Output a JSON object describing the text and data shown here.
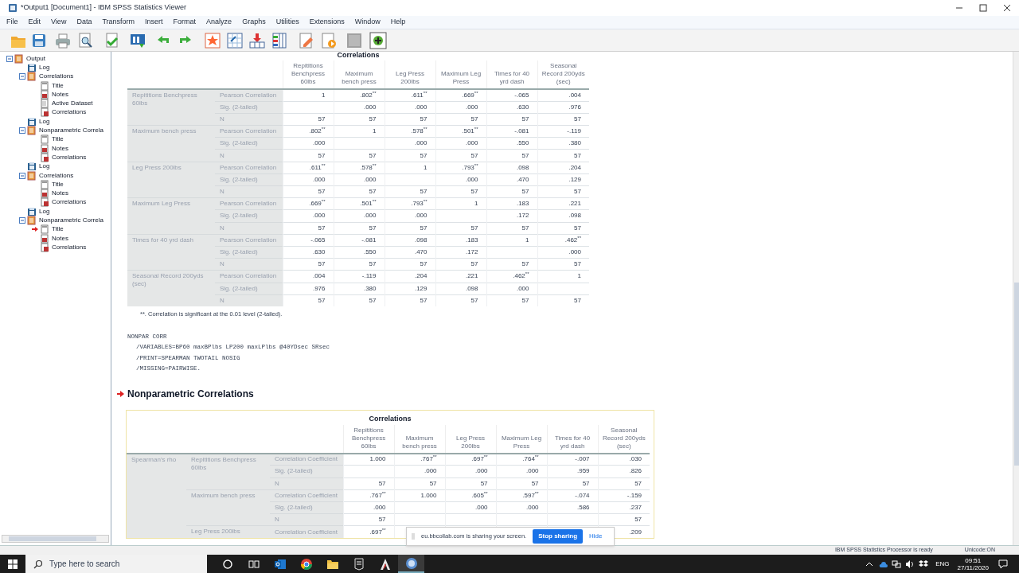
{
  "window": {
    "title": "*Output1 [Document1] - IBM SPSS Statistics Viewer"
  },
  "menu": [
    "File",
    "Edit",
    "View",
    "Data",
    "Transform",
    "Insert",
    "Format",
    "Analyze",
    "Graphs",
    "Utilities",
    "Extensions",
    "Window",
    "Help"
  ],
  "outline": [
    {
      "label": "Output",
      "kind": "folder",
      "expanded": true,
      "current": false,
      "children": [
        {
          "label": "Log",
          "kind": "log",
          "current": false
        },
        {
          "label": "Correlations",
          "kind": "folder",
          "expanded": true,
          "current": false,
          "children": [
            {
              "label": "Title",
              "kind": "title",
              "current": false
            },
            {
              "label": "Notes",
              "kind": "notes",
              "current": false
            },
            {
              "label": "Active Dataset",
              "kind": "dataset",
              "current": false
            },
            {
              "label": "Correlations",
              "kind": "table",
              "current": false
            }
          ]
        },
        {
          "label": "Log",
          "kind": "log",
          "current": false
        },
        {
          "label": "Nonparametric Correla",
          "kind": "folder",
          "expanded": true,
          "current": false,
          "children": [
            {
              "label": "Title",
              "kind": "title",
              "current": false
            },
            {
              "label": "Notes",
              "kind": "notes",
              "current": false
            },
            {
              "label": "Correlations",
              "kind": "table",
              "current": false
            }
          ]
        },
        {
          "label": "Log",
          "kind": "log",
          "current": false
        },
        {
          "label": "Correlations",
          "kind": "folder",
          "expanded": true,
          "current": false,
          "children": [
            {
              "label": "Title",
              "kind": "title",
              "current": false
            },
            {
              "label": "Notes",
              "kind": "notes",
              "current": false
            },
            {
              "label": "Correlations",
              "kind": "table",
              "current": false
            }
          ]
        },
        {
          "label": "Log",
          "kind": "log",
          "current": false
        },
        {
          "label": "Nonparametric Correla",
          "kind": "folder",
          "expanded": true,
          "current": false,
          "children": [
            {
              "label": "Title",
              "kind": "title",
              "current": true
            },
            {
              "label": "Notes",
              "kind": "notes",
              "current": false
            },
            {
              "label": "Correlations",
              "kind": "table",
              "current": false
            }
          ]
        }
      ]
    }
  ],
  "table_1": {
    "title": "Correlations",
    "columns": [
      "Repititions Benchpress 60lbs",
      "Maximum bench press",
      "Leg Press 200lbs",
      "Maximum Leg Press",
      "Times for 40 yrd dash",
      "Seasonal Record 200yds (sec)"
    ],
    "groups": [
      {
        "variable": "Repititions Benchpress 60lbs",
        "rows": [
          {
            "statistic": "Pearson Correlation",
            "cells": [
              "1",
              ".802$^{**}$",
              ".611$^{**}$",
              ".669$^{**}$",
              "-.065",
              ".004"
            ]
          },
          {
            "statistic": "Sig. (2-tailed)",
            "cells": [
              null,
              ".000",
              ".000",
              ".000",
              ".630",
              ".976"
            ]
          },
          {
            "statistic": "N",
            "cells": [
              "57",
              "57",
              "57",
              "57",
              "57",
              "57"
            ]
          }
        ]
      },
      {
        "variable": "Maximum bench press",
        "rows": [
          {
            "statistic": "Pearson Correlation",
            "cells": [
              ".802$^{**}$",
              "1",
              ".578$^{**}$",
              ".501$^{**}$",
              "-.081",
              "-.119"
            ]
          },
          {
            "statistic": "Sig. (2-tailed)",
            "cells": [
              ".000",
              null,
              ".000",
              ".000",
              ".550",
              ".380"
            ]
          },
          {
            "statistic": "N",
            "cells": [
              "57",
              "57",
              "57",
              "57",
              "57",
              "57"
            ]
          }
        ]
      },
      {
        "variable": "Leg Press 200lbs",
        "rows": [
          {
            "statistic": "Pearson Correlation",
            "cells": [
              ".611$^{**}$",
              ".578$^{**}$",
              "1",
              ".793$^{**}$",
              ".098",
              ".204"
            ]
          },
          {
            "statistic": "Sig. (2-tailed)",
            "cells": [
              ".000",
              ".000",
              null,
              ".000",
              ".470",
              ".129"
            ]
          },
          {
            "statistic": "N",
            "cells": [
              "57",
              "57",
              "57",
              "57",
              "57",
              "57"
            ]
          }
        ]
      },
      {
        "variable": "Maximum Leg Press",
        "rows": [
          {
            "statistic": "Pearson Correlation",
            "cells": [
              ".669$^{**}$",
              ".501$^{**}$",
              ".793$^{**}$",
              "1",
              ".183",
              ".221"
            ]
          },
          {
            "statistic": "Sig. (2-tailed)",
            "cells": [
              ".000",
              ".000",
              ".000",
              null,
              ".172",
              ".098"
            ]
          },
          {
            "statistic": "N",
            "cells": [
              "57",
              "57",
              "57",
              "57",
              "57",
              "57"
            ]
          }
        ]
      },
      {
        "variable": "Times for 40 yrd dash",
        "rows": [
          {
            "statistic": "Pearson Correlation",
            "cells": [
              "-.065",
              "-.081",
              ".098",
              ".183",
              "1",
              ".462$^{**}$"
            ]
          },
          {
            "statistic": "Sig. (2-tailed)",
            "cells": [
              ".630",
              ".550",
              ".470",
              ".172",
              null,
              ".000"
            ]
          },
          {
            "statistic": "N",
            "cells": [
              "57",
              "57",
              "57",
              "57",
              "57",
              "57"
            ]
          }
        ]
      },
      {
        "variable": "Seasonal Record 200yds (sec)",
        "rows": [
          {
            "statistic": "Pearson Correlation",
            "cells": [
              ".004",
              "-.119",
              ".204",
              ".221",
              ".462$^{**}$",
              "1"
            ]
          },
          {
            "statistic": "Sig. (2-tailed)",
            "cells": [
              ".976",
              ".380",
              ".129",
              ".098",
              ".000",
              null
            ]
          },
          {
            "statistic": "N",
            "cells": [
              "57",
              "57",
              "57",
              "57",
              "57",
              "57"
            ]
          }
        ]
      }
    ],
    "footnote": "**. Correlation is significant at the 0.01 level (2-tailed)."
  },
  "syntax": {
    "command": "NONPAR CORR",
    "subcommands": [
      "/VARIABLES=BP60 maxBPlbs LP200 maxLPlbs @40YDsec SRsec",
      "/PRINT=SPEARMAN TWOTAIL NOSIG",
      "/MISSING=PAIRWISE."
    ]
  },
  "heading": "Nonparametric Correlations",
  "table_2": {
    "title": "Correlations",
    "method": "Spearman's rho",
    "columns": [
      "Repititions Benchpress 60lbs",
      "Maximum bench press",
      "Leg Press 200lbs",
      "Maximum Leg Press",
      "Times for 40 yrd dash",
      "Seasonal Record 200yds (sec)"
    ],
    "groups": [
      {
        "variable": "Repititions Benchpress 60lbs",
        "rows": [
          {
            "statistic": "Correlation Coefficient",
            "cells": [
              "1.000",
              ".767$^{**}$",
              ".697$^{**}$",
              ".764$^{**}$",
              "-.007",
              ".030"
            ]
          },
          {
            "statistic": "Sig. (2-tailed)",
            "cells": [
              null,
              ".000",
              ".000",
              ".000",
              ".959",
              ".826"
            ]
          },
          {
            "statistic": "N",
            "cells": [
              "57",
              "57",
              "57",
              "57",
              "57",
              "57"
            ]
          }
        ]
      },
      {
        "variable": "Maximum bench press",
        "rows": [
          {
            "statistic": "Correlation Coefficient",
            "cells": [
              ".767$^{**}$",
              "1.000",
              ".605$^{**}$",
              ".597$^{**}$",
              "-.074",
              "-.159"
            ]
          },
          {
            "statistic": "Sig. (2-tailed)",
            "cells": [
              ".000",
              null,
              ".000",
              ".000",
              ".586",
              ".237"
            ]
          },
          {
            "statistic": "N",
            "cells": [
              "57",
              null,
              null,
              null,
              null,
              "57"
            ]
          }
        ]
      },
      {
        "variable": "Leg Press 200lbs",
        "rows": [
          {
            "statistic": "Correlation Coefficient",
            "cells": [
              ".697$^{**}$",
              null,
              null,
              null,
              null,
              ".209"
            ]
          }
        ]
      }
    ]
  },
  "share_bar": {
    "message": "eu.bbcollab.com is sharing your screen.",
    "stop_button": "Stop sharing",
    "hide_link": "Hide"
  },
  "status_bar": {
    "message": "IBM SPSS Statistics Processor is ready",
    "encoding": "Unicode:ON"
  },
  "taskbar": {
    "search_placeholder": "Type here to search",
    "language": "ENG",
    "time": "09:51",
    "date": "27/11/2020"
  }
}
